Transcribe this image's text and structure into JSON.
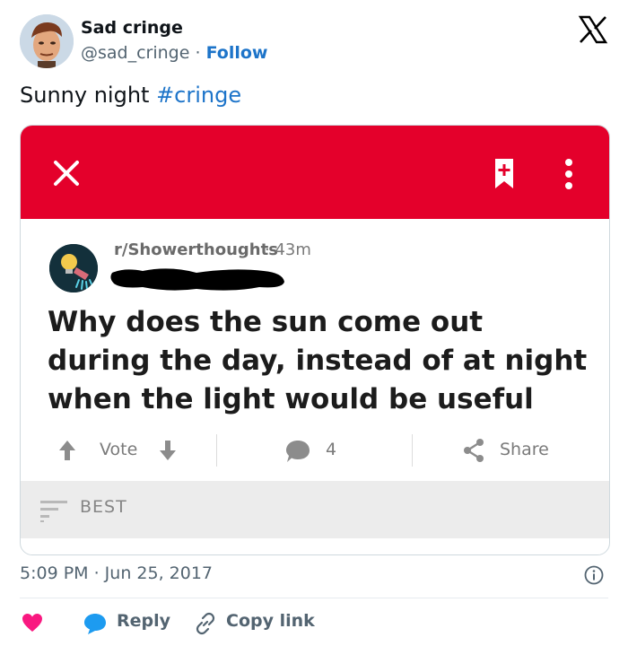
{
  "tweet": {
    "author_name": "Sad cringe",
    "handle": "@sad_cringe",
    "separator": "·",
    "follow_label": "Follow",
    "text_main": "Sunny night ",
    "hashtag": "#cringe",
    "timestamp": "5:09 PM · Jun 25, 2017"
  },
  "embedded_post": {
    "subreddit": "r/Showerthoughts",
    "time_ago": "· 43m",
    "title": "Why does the sun come out during the day, instead of at night when the light would be useful",
    "actions": {
      "vote_label": "Vote",
      "comment_count": "4",
      "share_label": "Share"
    },
    "sort_label": "BEST",
    "colors": {
      "header_red": "#e4002b"
    }
  },
  "footer": {
    "reply_label": "Reply",
    "copy_link_label": "Copy link"
  },
  "icons": [
    "x-logo-icon",
    "close-icon",
    "bookmark-plus-icon",
    "more-vertical-icon",
    "upvote-icon",
    "downvote-icon",
    "comment-icon",
    "share-icon",
    "sort-icon",
    "info-icon",
    "heart-icon",
    "reply-bubble-icon",
    "link-icon"
  ],
  "colors": {
    "link_blue": "#1d74c9",
    "heart_pink": "#f91880",
    "reply_blue": "#1d9bf0"
  }
}
